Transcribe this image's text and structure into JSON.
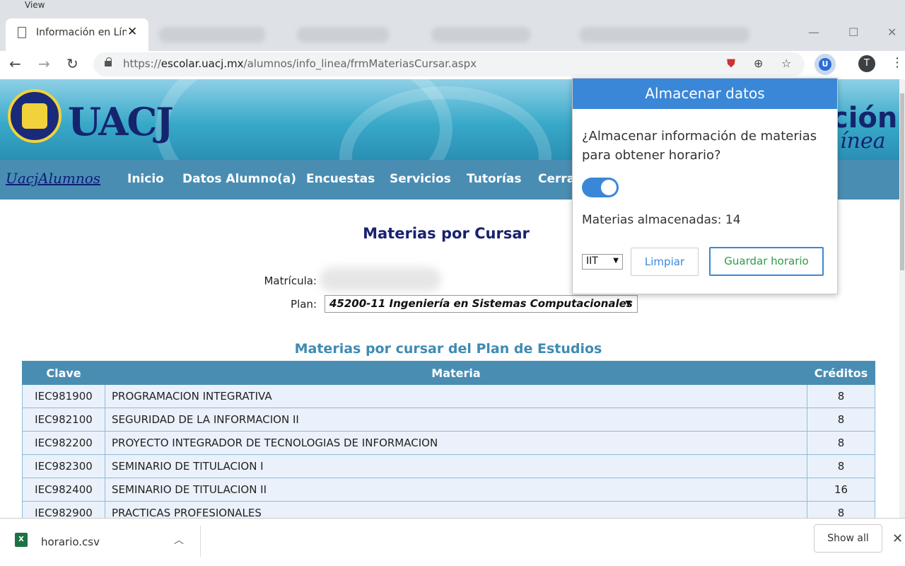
{
  "browser": {
    "menu_label": "View",
    "tab_title": "Información en Lín",
    "url_domain": "escolar.uacj.mx",
    "url_prefix": "https://",
    "url_path": "/alumnos/info_linea/frmMateriasCursar.aspx",
    "profile_initial": "T",
    "extension_icon_label": "U"
  },
  "site": {
    "logo_text": "UACJ",
    "brand_right_top": "ción",
    "brand_right_bottom": "ínea",
    "nav_brand": "UacjAlumnos",
    "nav_items": [
      "Inicio",
      "Datos Alumno(a)",
      "Encuestas",
      "Servicios",
      "Tutorías",
      "Cerra"
    ]
  },
  "content": {
    "page_title": "Materias por Cursar",
    "matricula_label": "Matrícula:",
    "plan_label": "Plan:",
    "plan_value": "45200-11 Ingeniería en Sistemas Computacionales",
    "section_title": "Materias por cursar del Plan de Estudios",
    "table": {
      "headers": [
        "Clave",
        "Materia",
        "Créditos"
      ],
      "rows": [
        [
          "IEC981900",
          "PROGRAMACION INTEGRATIVA",
          "8"
        ],
        [
          "IEC982100",
          "SEGURIDAD DE LA INFORMACION II",
          "8"
        ],
        [
          "IEC982200",
          "PROYECTO INTEGRADOR DE TECNOLOGIAS DE INFORMACION",
          "8"
        ],
        [
          "IEC982300",
          "SEMINARIO DE TITULACION I",
          "8"
        ],
        [
          "IEC982400",
          "SEMINARIO DE TITULACION II",
          "16"
        ],
        [
          "IEC982900",
          "PRACTICAS PROFESIONALES",
          "8"
        ]
      ]
    }
  },
  "popup": {
    "title": "Almacenar datos",
    "question": "¿Almacenar información de materias para obtener horario?",
    "toggle_on": true,
    "count_text": "Materias almacenadas: 14",
    "select_value": "IIT",
    "limpiar_label": "Limpiar",
    "guardar_label": "Guardar horario"
  },
  "downloads": {
    "file_name": "horario.csv",
    "show_all_label": "Show all"
  },
  "colors": {
    "nav_bg": "#4a8db3",
    "popup_accent": "#3a87d8",
    "guardar_text": "#2e9a4a",
    "title_color": "#1a2170"
  }
}
